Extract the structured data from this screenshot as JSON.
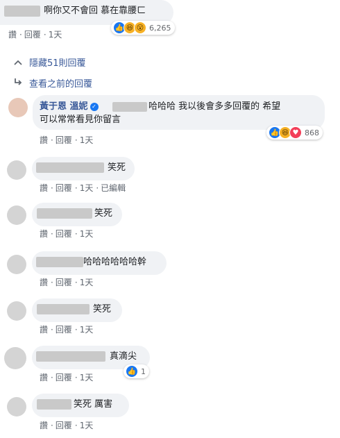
{
  "actions": {
    "like": "讚",
    "reply": "回覆",
    "sep": "·",
    "time": "1天",
    "edited": "已編輯"
  },
  "top_comment": {
    "text": "啊你又不會回 慕在靠腰ㄈ",
    "reaction_count": "6,265"
  },
  "links": {
    "hidden": "隱藏51則回覆",
    "previous": "查看之前的回覆"
  },
  "reply_main": {
    "author": "黃于恩 溫妮",
    "text_line1": "哈哈哈 我以後會多多回覆的 希望",
    "text_line2": "可以常常看見你留言",
    "reaction_count": "868"
  },
  "comments": [
    {
      "text": "笑死"
    },
    {
      "text": "笑死"
    },
    {
      "text": "哈哈哈哈哈哈幹"
    },
    {
      "text": "笑死"
    },
    {
      "text": "真滴尖",
      "reaction_count": "1"
    },
    {
      "text": "笑死 厲害"
    }
  ],
  "icons": {
    "expand": "chevron-up-icon",
    "previous": "reply-arrow-icon",
    "verified": "verified-badge-icon"
  },
  "colors": {
    "link": "#385898",
    "bubble": "#f0f2f5",
    "like": "#1877f2",
    "love": "#f33e58",
    "haha": "#f7b125"
  }
}
